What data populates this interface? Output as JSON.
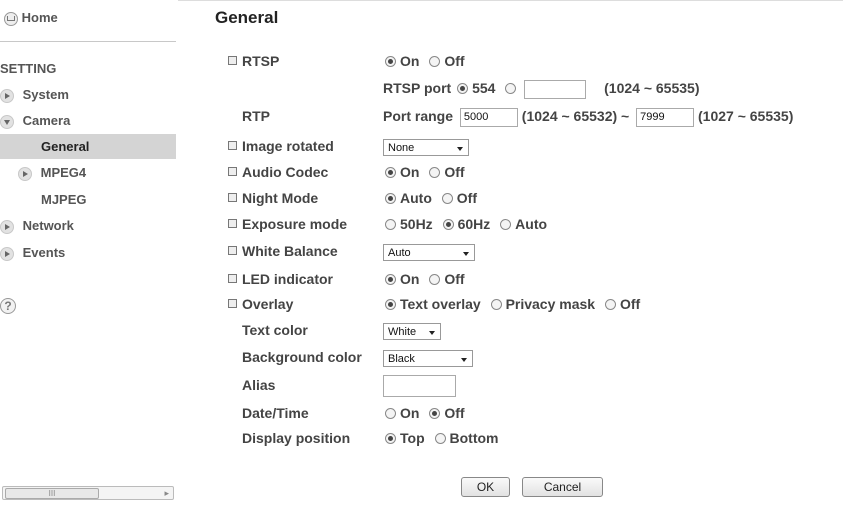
{
  "sidebar": {
    "home": "Home",
    "setting": "SETTING",
    "items": [
      {
        "label": "System"
      },
      {
        "label": "Camera"
      },
      {
        "label": "General"
      },
      {
        "label": "MPEG4"
      },
      {
        "label": "MJPEG"
      },
      {
        "label": "Network"
      },
      {
        "label": "Events"
      }
    ],
    "scroll_thumb": "III",
    "scroll_arrow": "▸"
  },
  "main": {
    "title": "General",
    "rtsp": {
      "label": "RTSP",
      "on": "On",
      "off": "Off",
      "selected": "On"
    },
    "rtsp_port": {
      "label": "RTSP port",
      "option": "554",
      "custom_value": "",
      "range": "(1024 ~ 65535)"
    },
    "rtp": {
      "label": "RTP",
      "port_range_label": "Port range",
      "from_value": "5000",
      "from_range": "(1024 ~ 65532) ~",
      "to_value": "7999",
      "to_range": "(1027 ~ 65535)"
    },
    "image_rotated": {
      "label": "Image rotated",
      "value": "None"
    },
    "audio_codec": {
      "label": "Audio Codec",
      "on": "On",
      "off": "Off",
      "selected": "On"
    },
    "night_mode": {
      "label": "Night Mode",
      "auto": "Auto",
      "off": "Off",
      "selected": "Auto"
    },
    "exposure_mode": {
      "label": "Exposure mode",
      "opt1": "50Hz",
      "opt2": "60Hz",
      "opt3": "Auto",
      "selected": "60Hz"
    },
    "white_balance": {
      "label": "White Balance",
      "value": "Auto"
    },
    "led_indicator": {
      "label": "LED indicator",
      "on": "On",
      "off": "Off",
      "selected": "On"
    },
    "overlay": {
      "label": "Overlay",
      "opt1": "Text overlay",
      "opt2": "Privacy mask",
      "opt3": "Off",
      "selected": "Text overlay"
    },
    "text_color": {
      "label": "Text color",
      "value": "White"
    },
    "background_color": {
      "label": "Background color",
      "value": "Black"
    },
    "alias": {
      "label": "Alias",
      "value": ""
    },
    "date_time": {
      "label": "Date/Time",
      "on": "On",
      "off": "Off",
      "selected": "Off"
    },
    "display_position": {
      "label": "Display position",
      "top": "Top",
      "bottom": "Bottom",
      "selected": "Top"
    },
    "ok_label": "OK",
    "cancel_label": "Cancel"
  }
}
